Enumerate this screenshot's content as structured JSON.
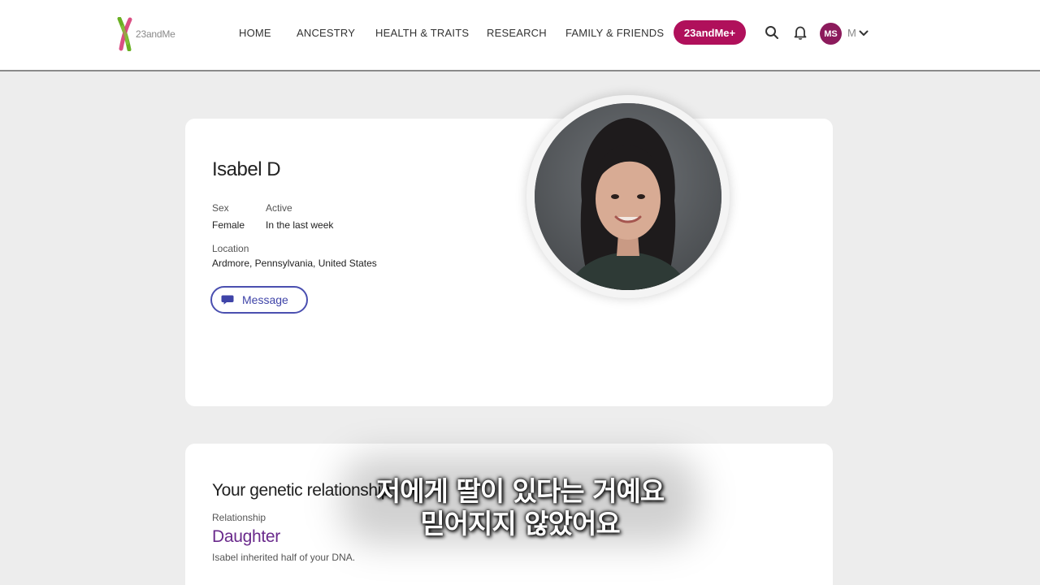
{
  "brand": {
    "logo_text": "23andMe"
  },
  "nav": {
    "items": [
      {
        "label": "HOME"
      },
      {
        "label": "ANCESTRY"
      },
      {
        "label": "HEALTH & TRAITS"
      },
      {
        "label": "RESEARCH"
      },
      {
        "label": "FAMILY & FRIENDS"
      }
    ],
    "plus_label": "23andMe+",
    "user_initials": "MS",
    "user_name": "M"
  },
  "profile": {
    "name": "Isabel D",
    "sex_label": "Sex",
    "sex_value": "Female",
    "active_label": "Active",
    "active_value": "In the last week",
    "location_label": "Location",
    "location_value": "Ardmore, Pennsylvania, United States",
    "message_label": "Message"
  },
  "relationship": {
    "title": "Your genetic relationship",
    "label": "Relationship",
    "value": "Daughter",
    "description": "Isabel inherited half of your DNA."
  },
  "subtitle": {
    "line1": "저에게 딸이 있다는 거예요",
    "line2": "믿어지지 않았어요"
  },
  "colors": {
    "accent": "#b0105b",
    "message_border": "#4a4fb0",
    "relationship_value": "#6a2a8c"
  }
}
